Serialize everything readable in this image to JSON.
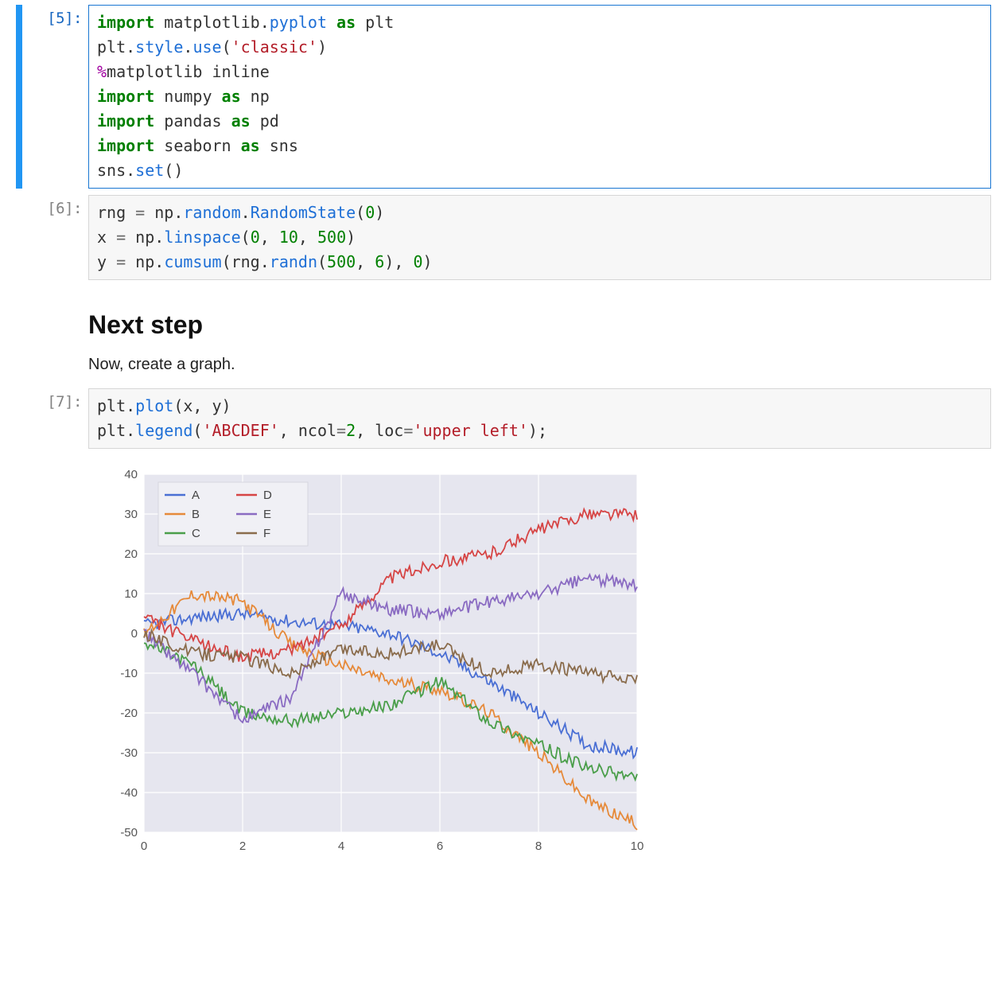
{
  "cells": {
    "c5": {
      "prompt": "[5]:",
      "code": {
        "l1": {
          "kw": "import",
          "mod": " matplotlib",
          "dot1": ".",
          "attr": "pyplot",
          "as": " as ",
          "alias": "plt"
        },
        "l2": {
          "p1": "plt",
          "dot1": ".",
          "a1": "style",
          "dot2": ".",
          "a2": "use",
          "p2": "(",
          "str": "'classic'",
          "p3": ")"
        },
        "l3": {
          "mag": "%",
          "rest": "matplotlib inline"
        },
        "l4": {
          "kw": "import",
          "mod": " numpy",
          "as": " as ",
          "alias": "np"
        },
        "l5": {
          "kw": "import",
          "mod": " pandas",
          "as": " as ",
          "alias": "pd"
        },
        "l6": {
          "kw": "import",
          "mod": " seaborn",
          "as": " as ",
          "alias": "sns"
        },
        "l7": {
          "p1": "sns",
          "dot1": ".",
          "a1": "set",
          "p2": "()"
        }
      }
    },
    "c6": {
      "prompt": "[6]:",
      "code": {
        "l1": {
          "v": "rng ",
          "op": "=",
          "sp": " np",
          "dot1": ".",
          "a1": "random",
          "dot2": ".",
          "a2": "RandomState",
          "p": "(",
          "n": "0",
          "cp": ")"
        },
        "l2": {
          "v": "x ",
          "op": "=",
          "sp": " np",
          "dot": ".",
          "a": "linspace",
          "p": "(",
          "n1": "0",
          "c1": ", ",
          "n2": "10",
          "c2": ", ",
          "n3": "500",
          "cp": ")"
        },
        "l3": {
          "v": "y ",
          "op": "=",
          "sp": " np",
          "dot": ".",
          "a": "cumsum",
          "p": "(rng",
          "dot2": ".",
          "a2": "randn",
          "p2": "(",
          "n1": "500",
          "c1": ", ",
          "n2": "6",
          "cp2": "), ",
          "n3": "0",
          "cp": ")"
        }
      }
    },
    "md": {
      "heading": "Next step",
      "body": "Now, create a graph."
    },
    "c7": {
      "prompt": "[7]:",
      "code": {
        "l1": {
          "p": "plt",
          "dot": ".",
          "a": "plot",
          "args": "(x, y)"
        },
        "l2": {
          "p": "plt",
          "dot": ".",
          "a": "legend",
          "op": "(",
          "s": "'ABCDEF'",
          "c1": ", ncol",
          "eq1": "=",
          "n1": "2",
          "c2": ", loc",
          "eq2": "=",
          "s2": "'upper left'",
          "cp": ");"
        }
      }
    }
  },
  "chart_data": {
    "type": "line",
    "title": "",
    "xlabel": "",
    "ylabel": "",
    "xlim": [
      0,
      10
    ],
    "ylim": [
      -50,
      40
    ],
    "xticks": [
      0,
      2,
      4,
      6,
      8,
      10
    ],
    "yticks": [
      -50,
      -40,
      -30,
      -20,
      -10,
      0,
      10,
      20,
      30,
      40
    ],
    "legend": {
      "position": "upper left",
      "ncol": 2,
      "entries": [
        "A",
        "B",
        "C",
        "D",
        "E",
        "F"
      ]
    },
    "colors": {
      "A": "#4a6fd4",
      "B": "#e68a3a",
      "C": "#4a9e4a",
      "D": "#d64545",
      "E": "#8a6bc2",
      "F": "#8a6c4c"
    },
    "x": [
      0,
      1,
      2,
      3,
      4,
      5,
      6,
      7,
      8,
      9,
      10
    ],
    "series": [
      {
        "name": "A",
        "values": [
          2,
          4,
          5,
          3,
          2,
          0,
          -5,
          -12,
          -20,
          -28,
          -30
        ]
      },
      {
        "name": "B",
        "values": [
          0,
          10,
          8,
          -3,
          -8,
          -12,
          -14,
          -20,
          -30,
          -42,
          -48
        ]
      },
      {
        "name": "C",
        "values": [
          -2,
          -8,
          -20,
          -22,
          -20,
          -18,
          -12,
          -22,
          -28,
          -34,
          -36
        ]
      },
      {
        "name": "D",
        "values": [
          4,
          -2,
          -6,
          -4,
          2,
          14,
          18,
          20,
          26,
          30,
          30
        ]
      },
      {
        "name": "E",
        "values": [
          0,
          -10,
          -22,
          -16,
          10,
          6,
          5,
          8,
          10,
          14,
          12
        ]
      },
      {
        "name": "F",
        "values": [
          0,
          -5,
          -6,
          -10,
          -4,
          -5,
          -3,
          -10,
          -8,
          -10,
          -12
        ]
      }
    ]
  }
}
